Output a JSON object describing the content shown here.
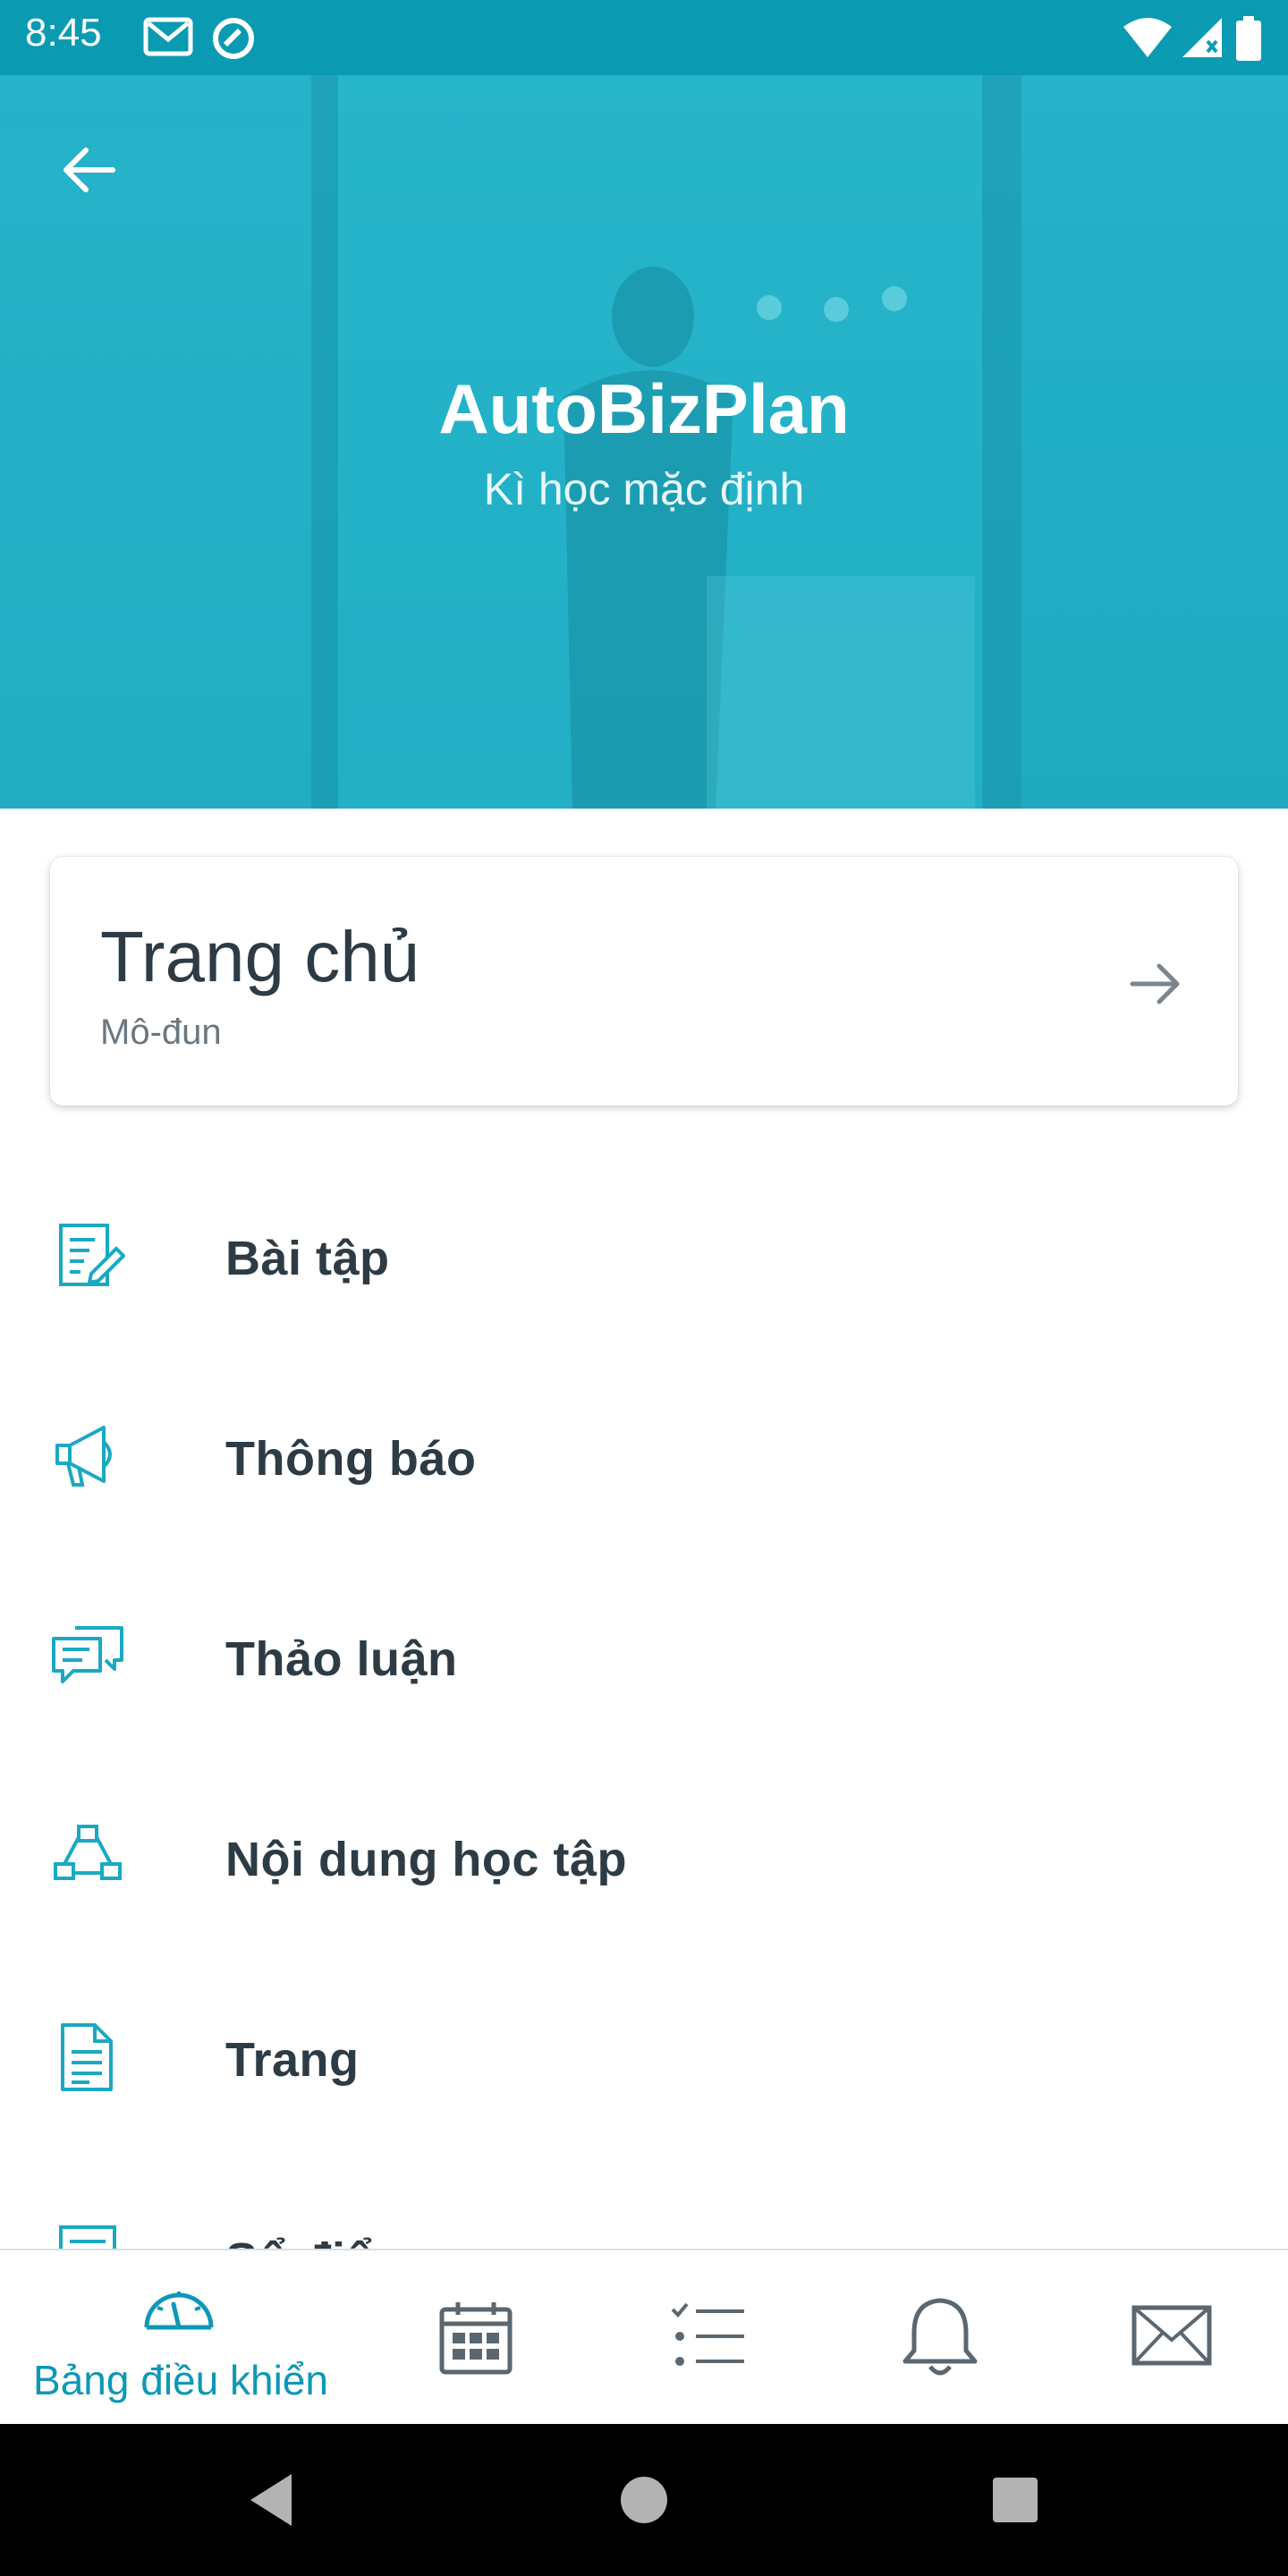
{
  "status_bar": {
    "time": "8:45",
    "icons": [
      "gmail-icon",
      "sync-icon",
      "wifi-icon",
      "signal-icon",
      "battery-icon"
    ]
  },
  "header": {
    "title": "AutoBizPlan",
    "subtitle": "Kì học mặc định",
    "background_color": "#22aec5",
    "back_icon": "arrow-left-icon"
  },
  "home_card": {
    "title": "Trang chủ",
    "subtitle": "Mô-đun",
    "icon": "arrow-right-icon"
  },
  "menu": {
    "items": [
      {
        "label": "Bài tập",
        "icon": "assignment-icon"
      },
      {
        "label": "Thông báo",
        "icon": "megaphone-icon"
      },
      {
        "label": "Thảo luận",
        "icon": "discussion-icon"
      },
      {
        "label": "Nội dung học tập",
        "icon": "modules-icon"
      },
      {
        "label": "Trang",
        "icon": "page-icon"
      },
      {
        "label": "Sổ điểm",
        "icon": "grades-icon"
      }
    ]
  },
  "bottom_nav": {
    "items": [
      {
        "label": "Bảng điều khiển",
        "icon": "dashboard-icon",
        "active": true
      },
      {
        "label": "",
        "icon": "calendar-icon",
        "active": false
      },
      {
        "label": "",
        "icon": "todo-icon",
        "active": false
      },
      {
        "label": "",
        "icon": "bell-icon",
        "active": false
      },
      {
        "label": "",
        "icon": "mail-icon",
        "active": false
      }
    ]
  },
  "colors": {
    "accent": "#1aa9c2",
    "status_bar": "#0a9bb2",
    "text_primary": "#2d3b45",
    "nav_inactive": "#5b6770"
  }
}
